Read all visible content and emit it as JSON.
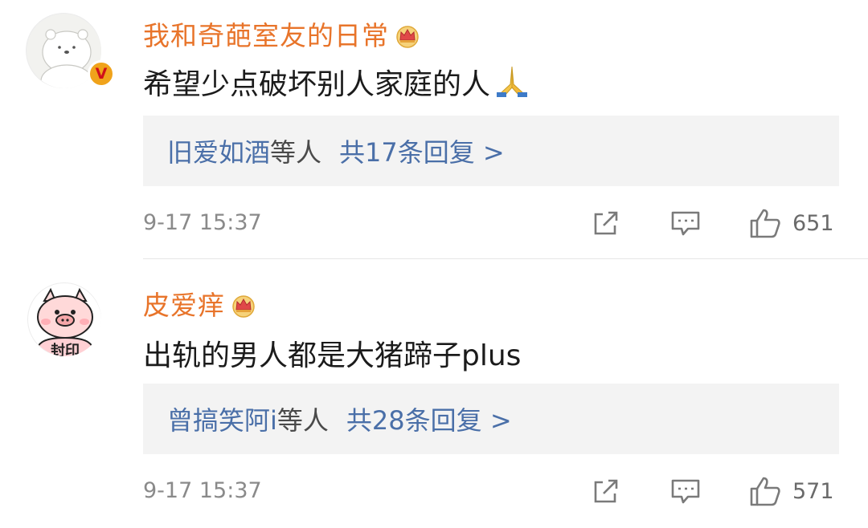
{
  "comments": [
    {
      "username": "我和奇葩室友的日常",
      "text": "希望少点破坏别人家庭的人",
      "emoji": "folded-hands",
      "badge": "V",
      "replies": {
        "names": "旧爱如酒",
        "suffix": "等人",
        "count": "共17条回复 >"
      },
      "timestamp": "9-17 15:37",
      "likes": "651"
    },
    {
      "username": "皮爱痒",
      "text": "出轨的男人都是大猪蹄子plus",
      "avatar_text": "封印",
      "replies": {
        "names": "曾搞笑阿i",
        "suffix": "等人",
        "count": "共28条回复 >"
      },
      "timestamp": "9-17 15:37",
      "likes": "571"
    }
  ],
  "colors": {
    "username": "#e8742a",
    "reply_link": "#4a6fa8",
    "reply_bg": "#f3f3f3",
    "meta": "#8a8a8a",
    "badge": "#f0a31b"
  },
  "icons": [
    "crown-icon",
    "share-icon",
    "comment-icon",
    "like-icon",
    "verified-badge-icon",
    "folded-hands-icon"
  ]
}
